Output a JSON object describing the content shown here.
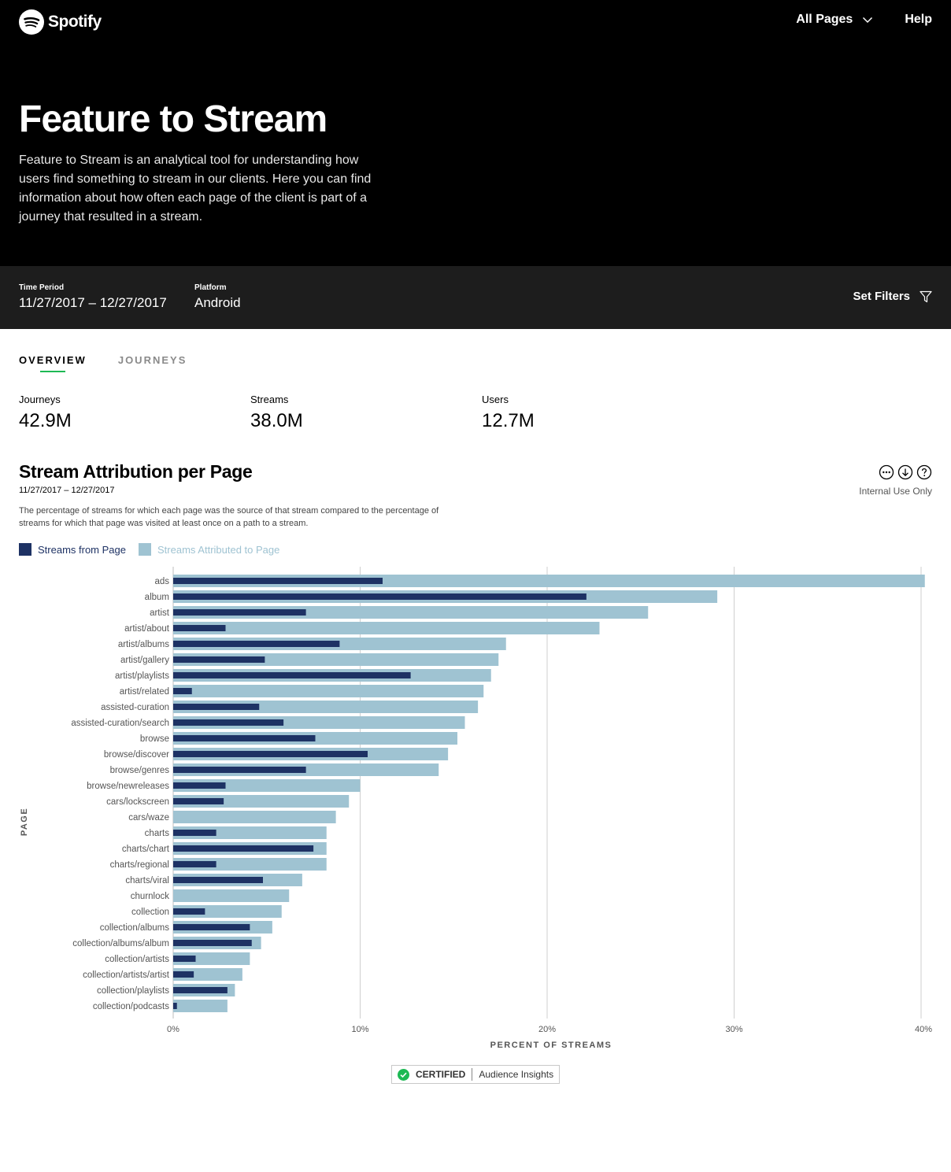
{
  "header": {
    "brand": "Spotify",
    "nav_pages": "All Pages",
    "nav_help": "Help"
  },
  "hero": {
    "title": "Feature to Stream",
    "description": "Feature to Stream is an analytical tool for understanding how users find something to stream in our clients. Here you can find information about how often each page of the client is part of a journey that resulted in a stream."
  },
  "filters": {
    "time_label": "Time Period",
    "time_value": "11/27/2017 – 12/27/2017",
    "platform_label": "Platform",
    "platform_value": "Android",
    "set_filters": "Set Filters"
  },
  "tabs": [
    {
      "label": "OVERVIEW",
      "active": true
    },
    {
      "label": "JOURNEYS",
      "active": false
    }
  ],
  "stats": [
    {
      "label": "Journeys",
      "value": "42.9M"
    },
    {
      "label": "Streams",
      "value": "38.0M"
    },
    {
      "label": "Users",
      "value": "12.7M"
    }
  ],
  "section": {
    "title": "Stream Attribution per Page",
    "date": "11/27/2017 – 12/27/2017",
    "description": "The percentage of streams for which each page was the source of that stream compared to the percentage of streams for which that page was visited at least once on a path to a stream.",
    "internal": "Internal Use Only"
  },
  "badge": {
    "certified": "CERTIFIED",
    "audience": "Audience Insights"
  },
  "colors": {
    "dark_series": "#1e3264",
    "light_series": "#9fc3d2",
    "accent": "#1db954"
  },
  "chart_data": {
    "type": "bar",
    "orientation": "horizontal",
    "categories": [
      "ads",
      "album",
      "artist",
      "artist/about",
      "artist/albums",
      "artist/gallery",
      "artist/playlists",
      "artist/related",
      "assisted-curation",
      "assisted-curation/search",
      "browse",
      "browse/discover",
      "browse/genres",
      "browse/newreleases",
      "cars/lockscreen",
      "cars/waze",
      "charts",
      "charts/chart",
      "charts/regional",
      "charts/viral",
      "churnlock",
      "collection",
      "collection/albums",
      "collection/albums/album",
      "collection/artists",
      "collection/artists/artist",
      "collection/playlists",
      "collection/podcasts"
    ],
    "series": [
      {
        "name": "Streams from Page",
        "color": "#1e3264",
        "values": [
          11.2,
          22.1,
          7.1,
          2.8,
          8.9,
          4.9,
          12.7,
          1.0,
          4.6,
          5.9,
          7.6,
          10.4,
          7.1,
          2.8,
          2.7,
          0,
          2.3,
          7.5,
          2.3,
          4.8,
          0,
          1.7,
          4.1,
          4.2,
          1.2,
          1.1,
          2.9,
          0.2
        ]
      },
      {
        "name": "Streams Attributed to Page",
        "color": "#9fc3d2",
        "values": [
          40.2,
          29.1,
          25.4,
          22.8,
          17.8,
          17.4,
          17.0,
          16.6,
          16.3,
          15.6,
          15.2,
          14.7,
          14.2,
          10.0,
          9.4,
          8.7,
          8.2,
          8.2,
          8.2,
          6.9,
          6.2,
          5.8,
          5.3,
          4.7,
          4.1,
          3.7,
          3.3,
          2.9
        ]
      }
    ],
    "xlabel": "PERCENT OF STREAMS",
    "ylabel": "PAGE",
    "xlim": [
      0,
      40
    ],
    "xticks": [
      "0%",
      "10%",
      "20%",
      "30%",
      "40%"
    ],
    "legend": "top-left",
    "grid": true
  }
}
